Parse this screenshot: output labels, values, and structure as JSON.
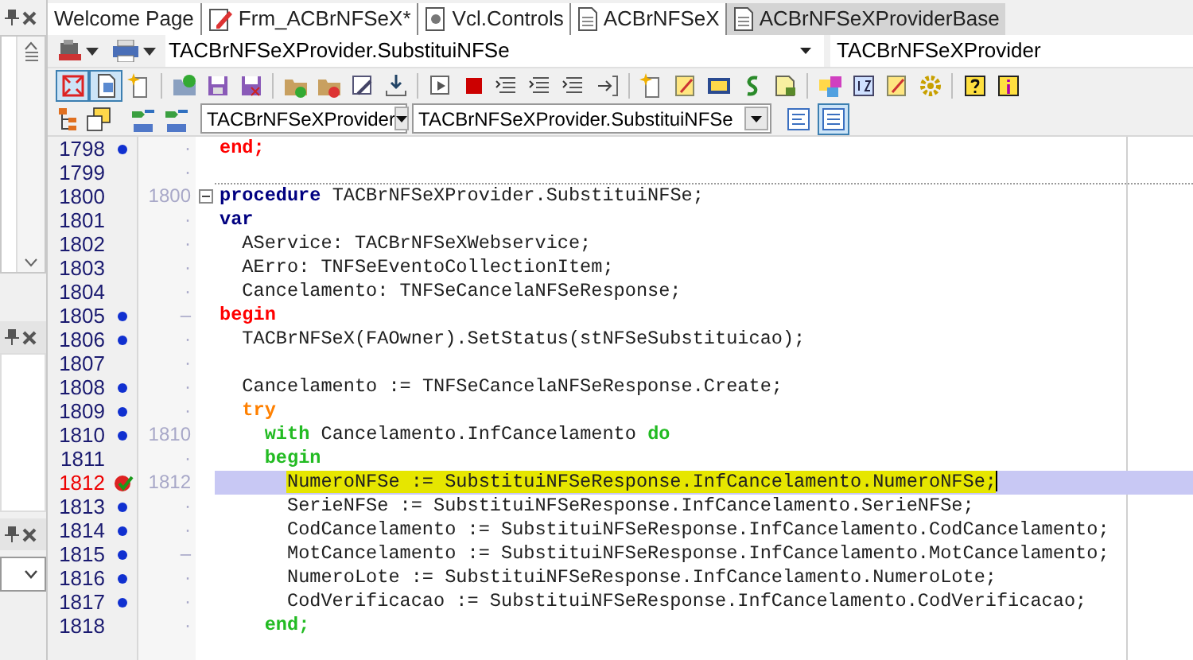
{
  "tabs": [
    {
      "label": "Welcome Page",
      "kind": "plain",
      "selected": false
    },
    {
      "label": "Frm_ACBrNFSeX*",
      "kind": "form",
      "selected": false
    },
    {
      "label": "Vcl.Controls",
      "kind": "unit",
      "selected": false
    },
    {
      "label": "ACBrNFSeX",
      "kind": "page",
      "selected": false
    },
    {
      "label": "ACBrNFSeXProviderBase",
      "kind": "page",
      "selected": true
    }
  ],
  "navigation": {
    "method_field": "TACBrNFSeXProvider.SubstituiNFSe",
    "class_field": "TACBrNFSeXProvider"
  },
  "toolbar": [
    [
      {
        "kind": "expand",
        "pressed": true
      },
      {
        "kind": "page",
        "pressed": true
      },
      {
        "kind": "star",
        "pressed": false
      }
    ],
    [
      {
        "kind": "open",
        "pressed": false
      },
      {
        "kind": "save",
        "pressed": false
      },
      {
        "kind": "saveall",
        "pressed": false
      }
    ],
    [
      {
        "kind": "folderadd",
        "pressed": false
      },
      {
        "kind": "folderdel",
        "pressed": false
      },
      {
        "kind": "tools",
        "pressed": false
      },
      {
        "kind": "download",
        "pressed": false
      }
    ],
    [
      {
        "kind": "run",
        "pressed": false
      },
      {
        "kind": "stop",
        "pressed": false
      },
      {
        "kind": "lines",
        "pressed": false
      },
      {
        "kind": "lines",
        "pressed": false
      },
      {
        "kind": "lines",
        "pressed": false
      },
      {
        "kind": "enter",
        "pressed": false
      }
    ],
    [
      {
        "kind": "star",
        "pressed": false
      },
      {
        "kind": "note",
        "pressed": false
      },
      {
        "kind": "window",
        "pressed": false
      },
      {
        "kind": "dollar",
        "pressed": false
      },
      {
        "kind": "lock",
        "pressed": false
      }
    ],
    [
      {
        "kind": "palette",
        "pressed": false
      },
      {
        "kind": "numbers",
        "pressed": false
      },
      {
        "kind": "note",
        "pressed": false
      },
      {
        "kind": "gear",
        "pressed": false
      }
    ],
    [
      {
        "kind": "help",
        "pressed": false
      },
      {
        "kind": "info",
        "pressed": false
      }
    ]
  ],
  "class_bar": {
    "class_combo": "TACBrNFSeXProvider",
    "method_combo": "TACBrNFSeXProvider.SubstituiNFSe",
    "align_buttons": [
      {
        "selected": false
      },
      {
        "selected": true
      }
    ]
  },
  "lines": [
    {
      "number": "1798",
      "dot": true,
      "marker": "·",
      "breakpoint": false,
      "current": false,
      "segments": [
        {
          "text": "end;",
          "color": "#ff0000"
        }
      ]
    },
    {
      "number": "1799",
      "dot": false,
      "marker": "·",
      "breakpoint": false,
      "current": false,
      "separator": true
    },
    {
      "number": "1800",
      "dot": false,
      "marker": "1800",
      "fold": true,
      "breakpoint": false,
      "current": false,
      "segments": [
        {
          "text": "procedure",
          "color": "#000080"
        },
        {
          "text": " TACBrNFSeXProvider.SubstituiNFSe;"
        }
      ]
    },
    {
      "number": "1801",
      "dot": false,
      "marker": "·",
      "breakpoint": false,
      "current": false,
      "segments": [
        {
          "text": "var",
          "color": "#000080"
        }
      ]
    },
    {
      "number": "1802",
      "dot": false,
      "marker": "·",
      "breakpoint": false,
      "current": false,
      "segments": [
        {
          "text": "  AService: TACBrNFSeXWebservice;"
        }
      ]
    },
    {
      "number": "1803",
      "dot": false,
      "marker": "·",
      "breakpoint": false,
      "current": false,
      "segments": [
        {
          "text": "  AErro: TNFSeEventoCollectionItem;"
        }
      ]
    },
    {
      "number": "1804",
      "dot": false,
      "marker": "·",
      "breakpoint": false,
      "current": false,
      "segments": [
        {
          "text": "  Cancelamento: TNFSeCancelaNFSeResponse;"
        }
      ]
    },
    {
      "number": "1805",
      "dot": true,
      "marker": "–",
      "breakpoint": false,
      "current": false,
      "segments": [
        {
          "text": "begin",
          "color": "#ff0000"
        }
      ]
    },
    {
      "number": "1806",
      "dot": true,
      "marker": "·",
      "breakpoint": false,
      "current": false,
      "segments": [
        {
          "text": "  TACBrNFSeX(FAOwner).SetStatus(stNFSeSubstituicao);"
        }
      ]
    },
    {
      "number": "1807",
      "dot": false,
      "marker": "·",
      "breakpoint": false,
      "current": false
    },
    {
      "number": "1808",
      "dot": true,
      "marker": "·",
      "breakpoint": false,
      "current": false,
      "segments": [
        {
          "text": "  Cancelamento := TNFSeCancelaNFSeResponse.Create;"
        }
      ]
    },
    {
      "number": "1809",
      "dot": true,
      "marker": "·",
      "breakpoint": false,
      "current": false,
      "segments": [
        {
          "text": "  try",
          "color": "#ff8000"
        }
      ]
    },
    {
      "number": "1810",
      "dot": true,
      "marker": "1810",
      "breakpoint": false,
      "current": false,
      "segments": [
        {
          "text": "    with",
          "color": "#22bb22"
        },
        {
          "text": " Cancelamento.InfCancelamento "
        },
        {
          "text": "do",
          "color": "#22bb22"
        }
      ]
    },
    {
      "number": "1811",
      "dot": false,
      "marker": "·",
      "breakpoint": false,
      "current": false,
      "segments": [
        {
          "text": "    begin",
          "color": "#22bb22"
        }
      ]
    },
    {
      "number": "1812",
      "marker": "1812",
      "breakpoint": true,
      "current": true,
      "segments": [
        {
          "text": "      NumeroNFSe := SubstituiNFSeResponse.InfCancelamento.NumeroNFSe;"
        }
      ]
    },
    {
      "number": "1813",
      "dot": true,
      "marker": "·",
      "breakpoint": false,
      "current": false,
      "segments": [
        {
          "text": "      SerieNFSe := SubstituiNFSeResponse.InfCancelamento.SerieNFSe;"
        }
      ]
    },
    {
      "number": "1814",
      "dot": true,
      "marker": "·",
      "breakpoint": false,
      "current": false,
      "segments": [
        {
          "text": "      CodCancelamento := SubstituiNFSeResponse.InfCancelamento.CodCancelamento;"
        }
      ]
    },
    {
      "number": "1815",
      "dot": true,
      "marker": "–",
      "breakpoint": false,
      "current": false,
      "segments": [
        {
          "text": "      MotCancelamento := SubstituiNFSeResponse.InfCancelamento.MotCancelamento;"
        }
      ]
    },
    {
      "number": "1816",
      "dot": true,
      "marker": "·",
      "breakpoint": false,
      "current": false,
      "segments": [
        {
          "text": "      NumeroLote := SubstituiNFSeResponse.InfCancelamento.NumeroLote;"
        }
      ]
    },
    {
      "number": "1817",
      "dot": true,
      "marker": "·",
      "breakpoint": false,
      "current": false,
      "segments": [
        {
          "text": "      CodVerificacao := SubstituiNFSeResponse.InfCancelamento.CodVerificacao;"
        }
      ]
    },
    {
      "number": "1818",
      "dot": false,
      "marker": "·",
      "breakpoint": false,
      "current": false,
      "segments": [
        {
          "text": "    end;",
          "color": "#22bb22"
        }
      ]
    }
  ]
}
